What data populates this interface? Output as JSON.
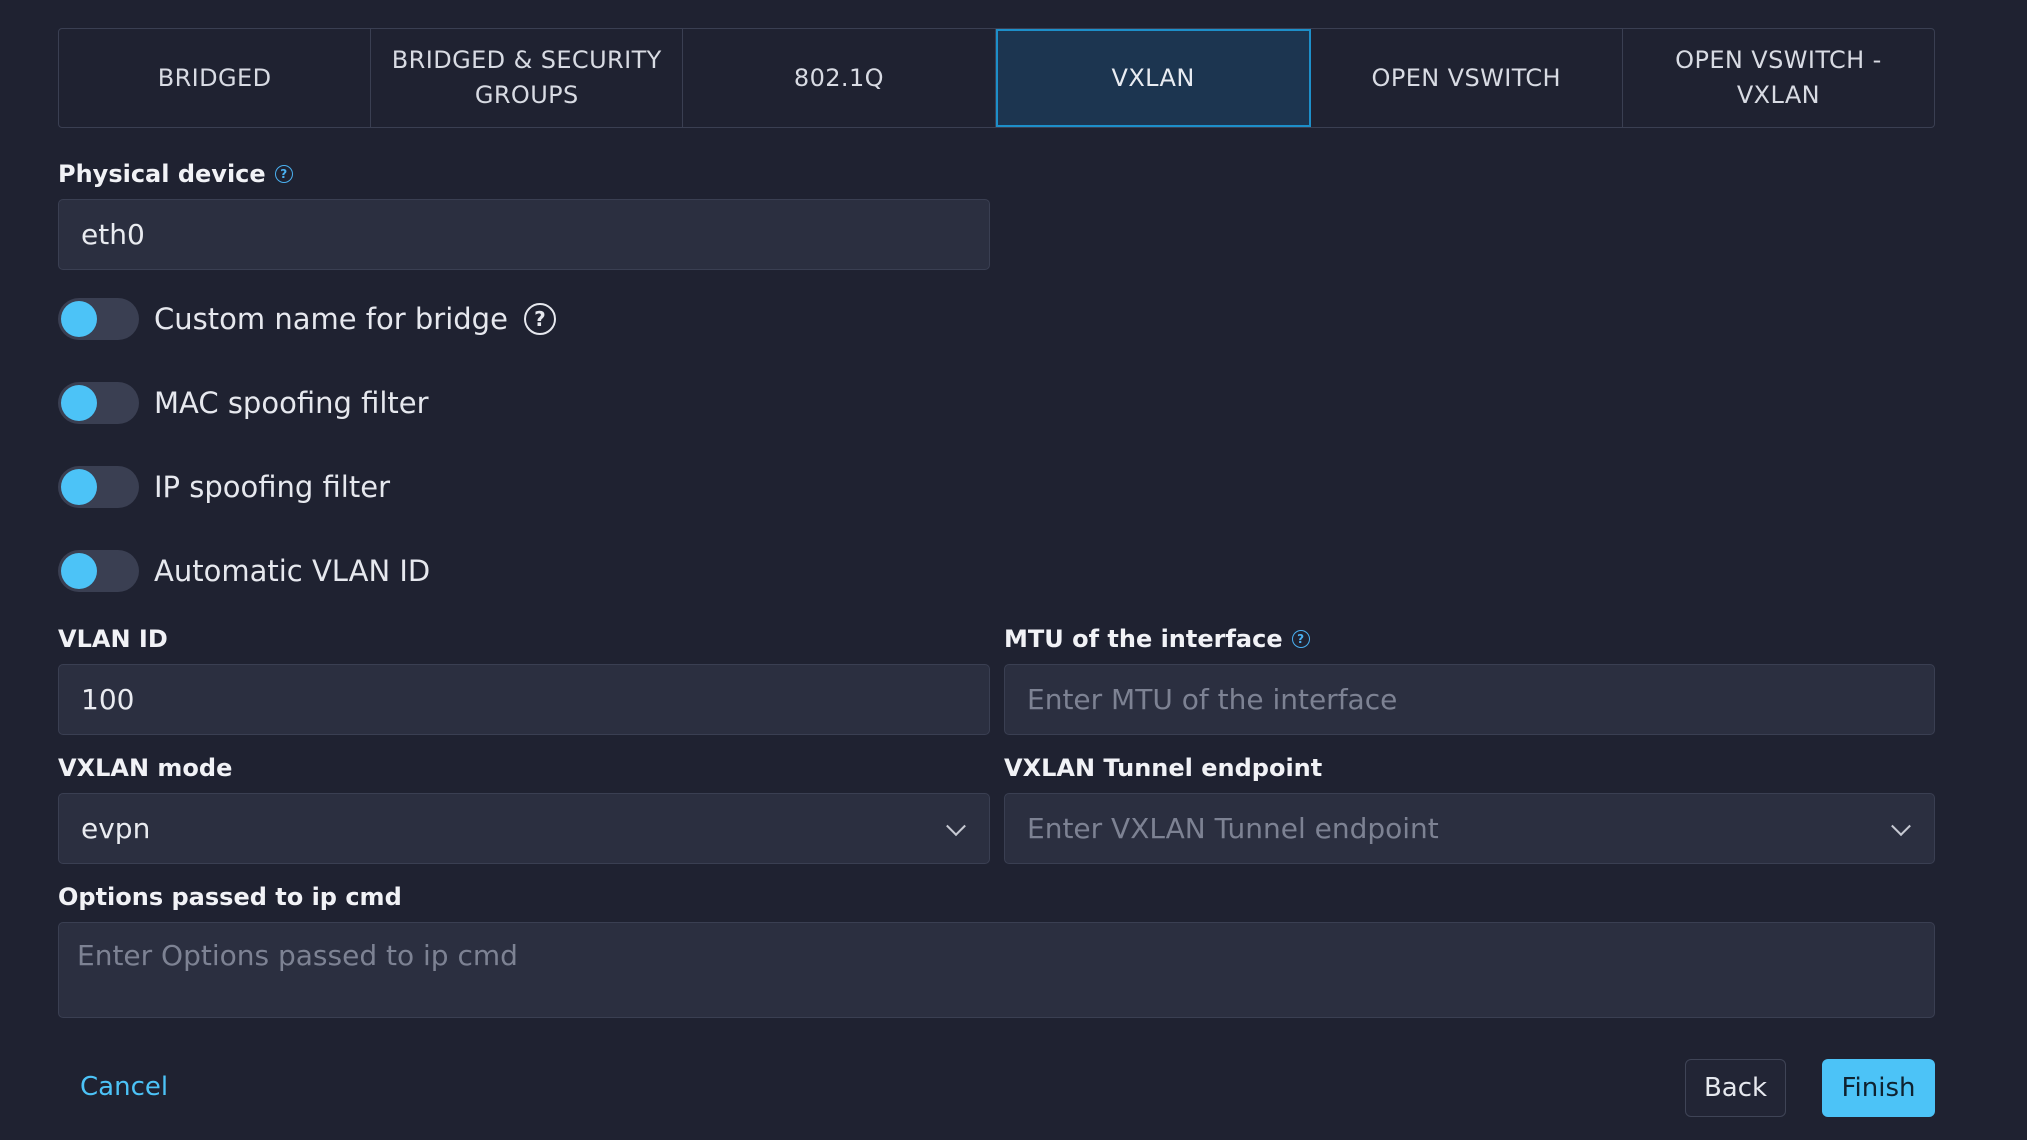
{
  "tabs": [
    {
      "label": "BRIDGED"
    },
    {
      "label": "BRIDGED & SECURITY GROUPS"
    },
    {
      "label": "802.1Q"
    },
    {
      "label": "VXLAN",
      "active": true
    },
    {
      "label": "OPEN VSWITCH"
    },
    {
      "label": "OPEN VSWITCH - VXLAN"
    }
  ],
  "physical_device": {
    "label": "Physical device",
    "value": "eth0"
  },
  "toggles": {
    "custom_name": {
      "label": "Custom name for bridge",
      "on": false
    },
    "mac_spoofing": {
      "label": "MAC spoofing filter",
      "on": false
    },
    "ip_spoofing": {
      "label": "IP spoofing filter",
      "on": false
    },
    "auto_vlan": {
      "label": "Automatic VLAN ID",
      "on": false
    }
  },
  "vlan_id": {
    "label": "VLAN ID",
    "value": "100"
  },
  "mtu": {
    "label": "MTU of the interface",
    "placeholder": "Enter MTU of the interface"
  },
  "vxlan_mode": {
    "label": "VXLAN mode",
    "value": "evpn"
  },
  "vxlan_endpoint": {
    "label": "VXLAN Tunnel endpoint",
    "placeholder": "Enter VXLAN Tunnel endpoint"
  },
  "ip_options": {
    "label": "Options passed to ip cmd",
    "placeholder": "Enter Options passed to ip cmd"
  },
  "footer": {
    "cancel": "Cancel",
    "back": "Back",
    "finish": "Finish"
  },
  "colors": {
    "accent": "#4cc3f7",
    "background": "#1f2231",
    "active_tab": "#1c3550"
  }
}
